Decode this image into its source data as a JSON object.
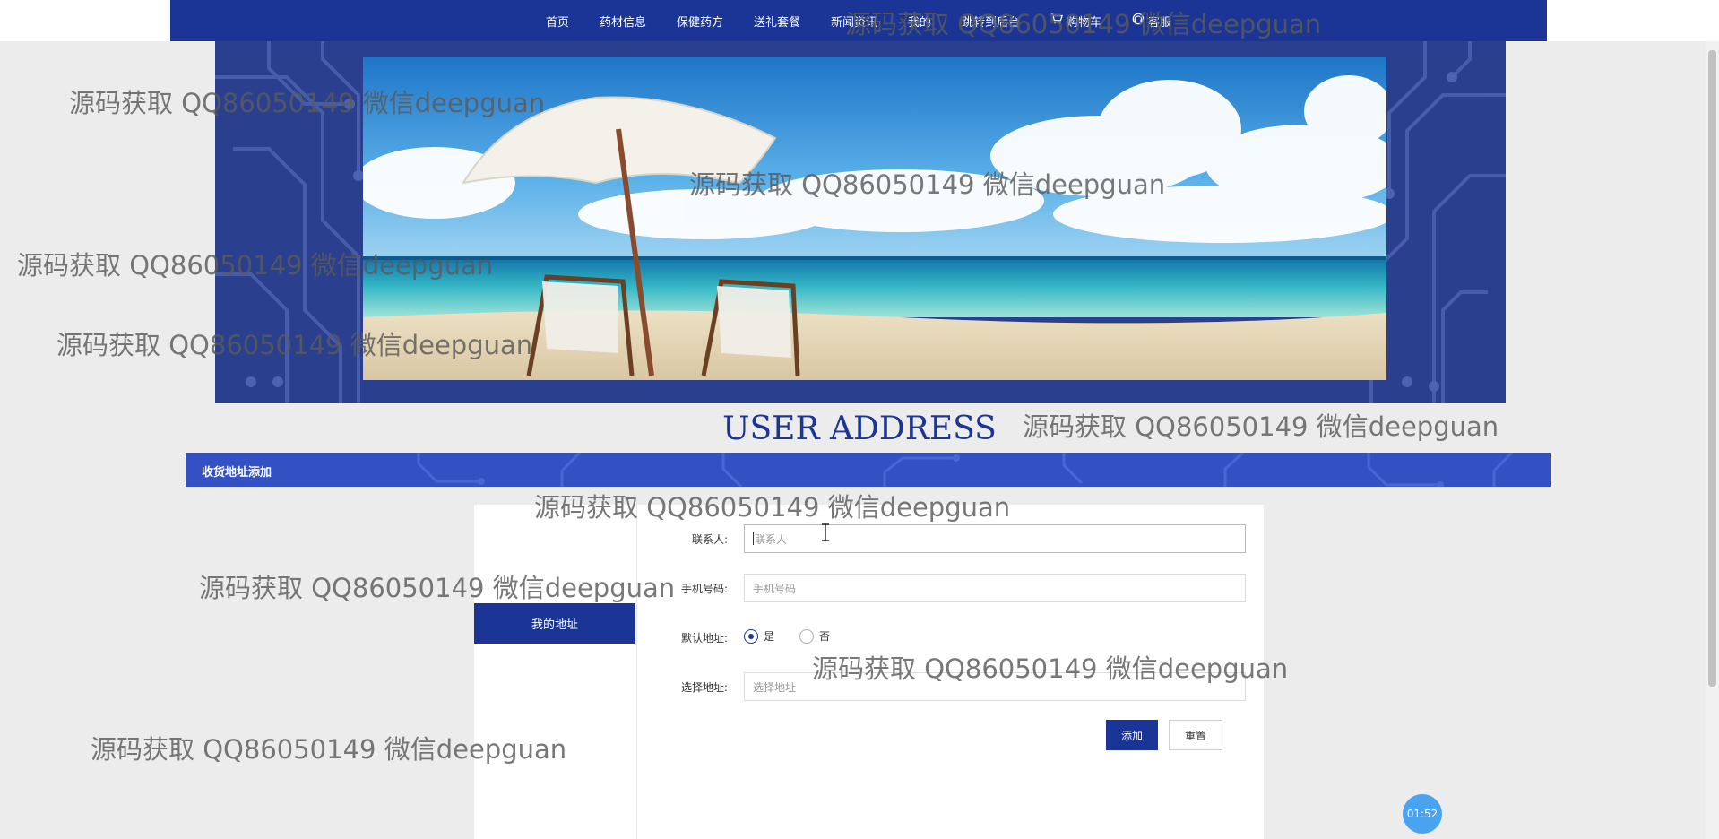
{
  "nav": {
    "items": [
      {
        "label": "首页"
      },
      {
        "label": "药材信息"
      },
      {
        "label": "保健药方"
      },
      {
        "label": "送礼套餐"
      },
      {
        "label": "新闻资讯"
      },
      {
        "label": "我的"
      },
      {
        "label": "跳转到后台"
      },
      {
        "label": "购物车",
        "icon": "cart-icon"
      },
      {
        "label": "客服",
        "icon": "headset-icon"
      }
    ]
  },
  "section": {
    "title": "USER ADDRESS",
    "band_label": "收货地址添加"
  },
  "sidebar": {
    "items": [
      {
        "label": "我的地址",
        "active": true
      }
    ]
  },
  "form": {
    "contact": {
      "label": "联系人:",
      "placeholder": "联系人",
      "value": ""
    },
    "phone": {
      "label": "手机号码:",
      "placeholder": "手机号码",
      "value": ""
    },
    "default": {
      "label": "默认地址:",
      "options": [
        "是",
        "否"
      ],
      "selected": "是"
    },
    "address": {
      "label": "选择地址:",
      "placeholder": "选择地址",
      "value": ""
    },
    "submit_label": "添加",
    "reset_label": "重置"
  },
  "timer": {
    "value": "01:52"
  },
  "watermark": {
    "text": "源码获取 QQ86050149 微信deepguan"
  },
  "colors": {
    "brand": "#1b3596",
    "band": "#3451c4",
    "timer": "#4aa3f0",
    "page_bg": "#ececec"
  }
}
